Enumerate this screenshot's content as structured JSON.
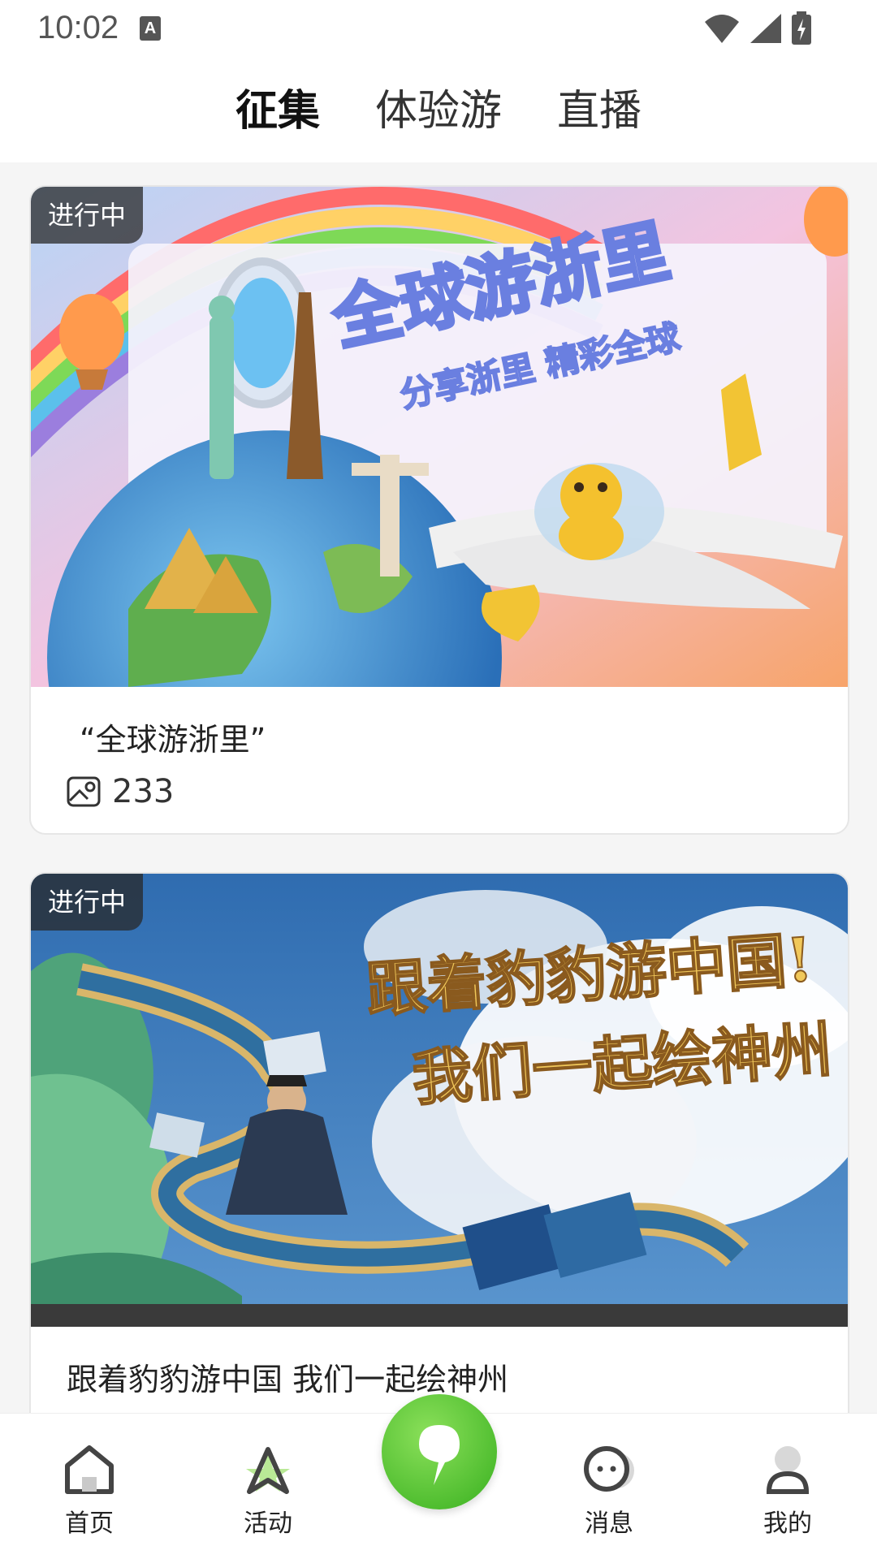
{
  "status_bar": {
    "time": "10:02",
    "notification_icon": "A"
  },
  "top_tabs": [
    {
      "label": "征集",
      "active": true
    },
    {
      "label": "体验游",
      "active": false
    },
    {
      "label": "直播",
      "active": false
    }
  ],
  "cards": [
    {
      "badge": "进行中",
      "image_text_main": "全球游浙里",
      "image_text_sub": "分享浙里 精彩全球",
      "title": "“全球游浙里”",
      "count": "233",
      "count_icon": "image-icon"
    },
    {
      "badge": "进行中",
      "image_text_main": "跟着豹豹游中国!",
      "image_text_sub": "我们一起绘神州",
      "title": "跟着豹豹游中国 我们一起绘神州"
    }
  ],
  "bottom_nav": [
    {
      "label": "首页",
      "icon": "home-icon"
    },
    {
      "label": "活动",
      "icon": "activity-icon"
    },
    {
      "label": "",
      "icon": "publish-icon"
    },
    {
      "label": "消息",
      "icon": "message-icon"
    },
    {
      "label": "我的",
      "icon": "profile-icon"
    }
  ],
  "colors": {
    "accent_green": "#4cc02a",
    "badge_bg": "#2d2d2d"
  }
}
